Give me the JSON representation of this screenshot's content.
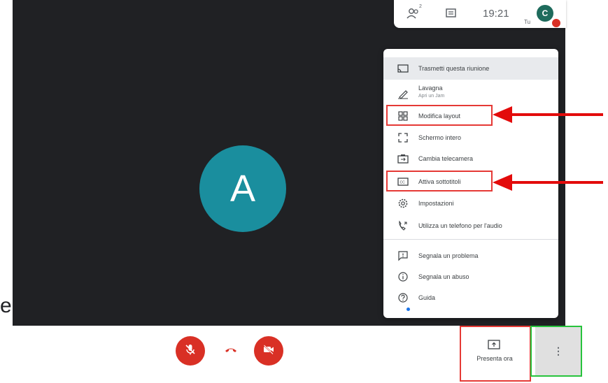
{
  "page": {
    "cut_letter": "e"
  },
  "participant": {
    "initial": "A"
  },
  "topbar": {
    "people_icon": "people-icon",
    "people_count": "2",
    "chat_icon": "chat-icon",
    "time": "19:21",
    "you_label": "Tu",
    "avatar_initial": "C"
  },
  "menu": {
    "items": [
      {
        "label": "Trasmetti questa riunione",
        "icon": "cast-icon"
      },
      {
        "label": "Lavagna",
        "sublabel": "Apri un Jam",
        "icon": "pen-icon"
      },
      {
        "label": "Modifica layout",
        "icon": "layout-icon"
      },
      {
        "label": "Schermo intero",
        "icon": "fullscreen-icon"
      },
      {
        "label": "Cambia telecamera",
        "icon": "switch-camera-icon"
      },
      {
        "label": "Attiva sottotitoli",
        "icon": "captions-icon"
      },
      {
        "label": "Impostazioni",
        "icon": "gear-icon"
      },
      {
        "label": "Utilizza un telefono per l'audio",
        "icon": "phone-audio-icon"
      },
      {
        "label": "Segnala un problema",
        "icon": "feedback-icon"
      },
      {
        "label": "Segnala un abuso",
        "icon": "info-icon"
      },
      {
        "label": "Guida",
        "icon": "help-icon"
      }
    ]
  },
  "controls": {
    "present_label": "Presenta ora",
    "more_label": "⋮"
  },
  "colors": {
    "stage_bg": "#202124",
    "avatar_bg": "#1a8e9e",
    "danger_red": "#d93025",
    "annotation_red": "#e53935",
    "annotation_green": "#27c33c"
  }
}
